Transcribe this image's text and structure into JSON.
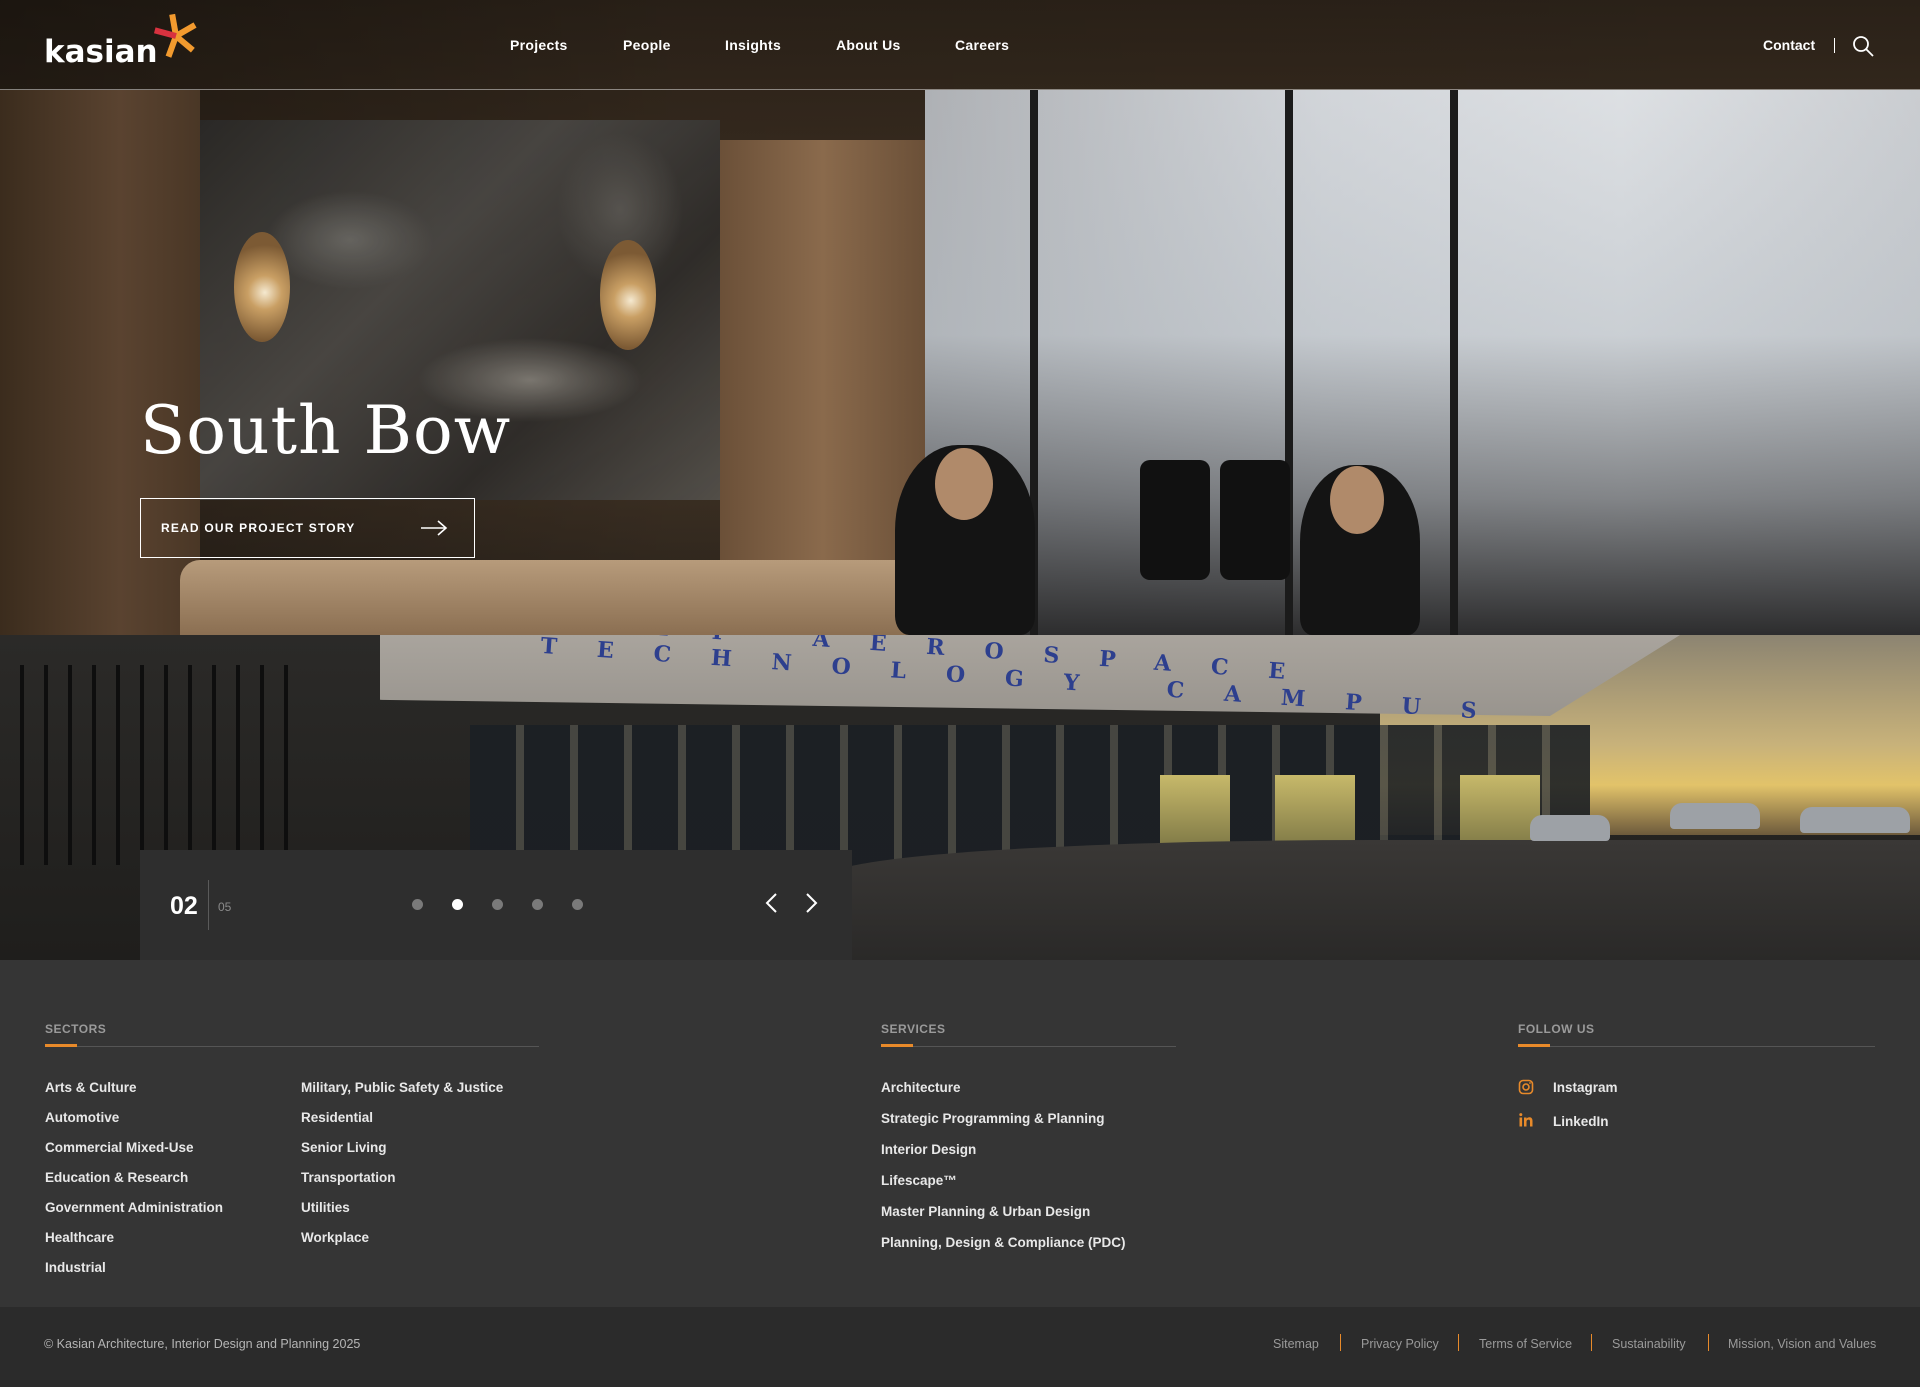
{
  "brand": {
    "logo_text": "kasian",
    "accent_color": "#e88a2a",
    "star_colors": [
      "#f29a2e",
      "#d8323f"
    ]
  },
  "nav": {
    "items": [
      "Projects",
      "People",
      "Insights",
      "About Us",
      "Careers"
    ],
    "contact_label": "Contact",
    "search_icon": "search-icon"
  },
  "hero": {
    "title": "South Bow",
    "cta_label": "READ OUR PROJECT STORY",
    "cta_icon": "arrow-right-icon"
  },
  "slide2": {
    "signage": "BCIT AEROSPACE TECHNOLOGY CAMPUS"
  },
  "slider": {
    "current": "02",
    "total": "05",
    "dot_count": 5,
    "active_index": 1,
    "prev_icon": "chevron-left-icon",
    "next_icon": "chevron-right-icon"
  },
  "footer": {
    "sectors": {
      "title": "SECTORS",
      "col1": [
        "Arts & Culture",
        "Automotive",
        "Commercial Mixed-Use",
        "Education & Research",
        "Government Administration",
        "Healthcare",
        "Industrial"
      ],
      "col2": [
        "Military, Public Safety & Justice",
        "Residential",
        "Senior Living",
        "Transportation",
        "Utilities",
        "Workplace"
      ]
    },
    "services": {
      "title": "SERVICES",
      "items": [
        "Architecture",
        "Strategic Programming & Planning",
        "Interior Design",
        "Lifescape™",
        "Master Planning & Urban Design",
        "Planning, Design & Compliance (PDC)"
      ]
    },
    "follow": {
      "title": "FOLLOW US",
      "items": [
        {
          "label": "Instagram",
          "icon": "instagram-icon"
        },
        {
          "label": "LinkedIn",
          "icon": "linkedin-icon"
        }
      ]
    }
  },
  "bottom": {
    "copyright": "© Kasian Architecture, Interior Design and Planning 2025",
    "links": [
      "Sitemap",
      "Privacy Policy",
      "Terms of Service",
      "Sustainability",
      "Mission, Vision and Values"
    ]
  }
}
